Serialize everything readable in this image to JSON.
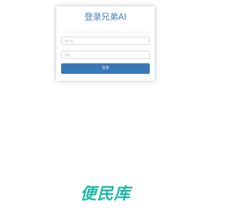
{
  "login": {
    "title": "登录兄弟AI",
    "username": {
      "value": "",
      "placeholder": "用户名"
    },
    "password": {
      "value": "",
      "placeholder": "密码"
    },
    "submit_label": "登录"
  },
  "footer": {
    "logo_text": "便民库"
  },
  "colors": {
    "title": "#3f7ab8",
    "button": "#3978b8",
    "logo": "#1bb8a4",
    "background": "#ffffff"
  }
}
